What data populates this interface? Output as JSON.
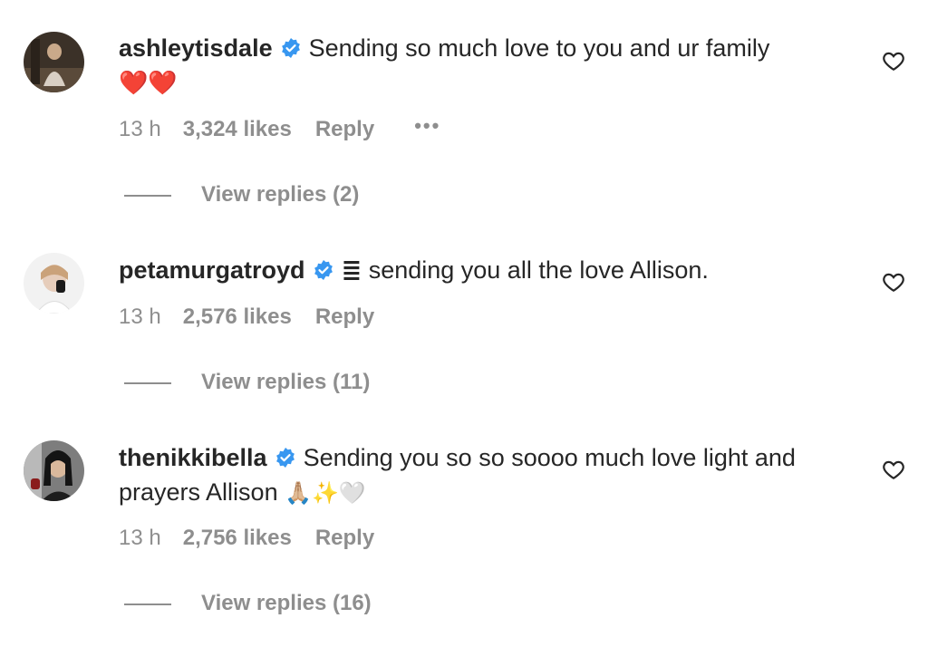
{
  "comments": [
    {
      "username": "ashleytisdale",
      "verified": true,
      "text": "Sending so much love to you and ur family",
      "emoji": "❤️❤️",
      "time": "13 h",
      "likes": "3,324 likes",
      "reply_label": "Reply",
      "more_label": "•••",
      "view_replies": "View replies (2)",
      "avatar_icon": "avatar-photo"
    },
    {
      "username": "petamurgatroyd",
      "verified": true,
      "text": "sending you all the love Allison.",
      "emoji": "≣",
      "time": "13 h",
      "likes": "2,576 likes",
      "reply_label": "Reply",
      "view_replies": "View replies (11)",
      "avatar_icon": "avatar-photo"
    },
    {
      "username": "thenikkibella",
      "verified": true,
      "text": "Sending you so so soooo much love light and prayers Allison",
      "emoji": "🙏🏼✨🤍",
      "time": "13 h",
      "likes": "2,756 likes",
      "reply_label": "Reply",
      "view_replies": "View replies (16)",
      "avatar_icon": "avatar-photo"
    }
  ],
  "colors": {
    "text": "#262626",
    "secondary": "#8e8e8e",
    "verified_blue": "#3897f0",
    "emoji_heart": "#e02020"
  },
  "icons": {
    "like": "heart-outline-icon",
    "verified": "verified-badge-icon"
  }
}
